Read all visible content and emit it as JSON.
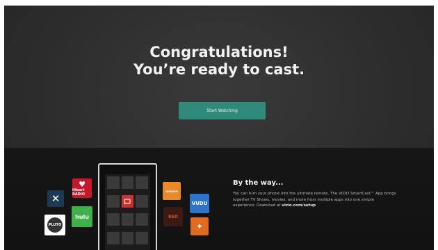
{
  "headline": {
    "line1": "Congratulations!",
    "line2": "You’re ready to cast."
  },
  "cta": {
    "label": "Start Watching"
  },
  "app_tiles": {
    "iheart_label": "iHeart RADIO",
    "hulu_label": "hulu",
    "pluto_label": "PLUTO",
    "vudu_label": "VUDU",
    "amazon_label": "amazon",
    "red_label": "RED"
  },
  "info": {
    "title": "By the way...",
    "body": "You can turn your phone into the ultimate remote. The VIZIO SmartCast™ App brings together TV Shows, movies, and more from multiple apps into one simple experience. Download at",
    "link": "vizio.com/setup"
  },
  "colors": {
    "accent": "#2f8a7a",
    "background": "#2c2c2c"
  }
}
